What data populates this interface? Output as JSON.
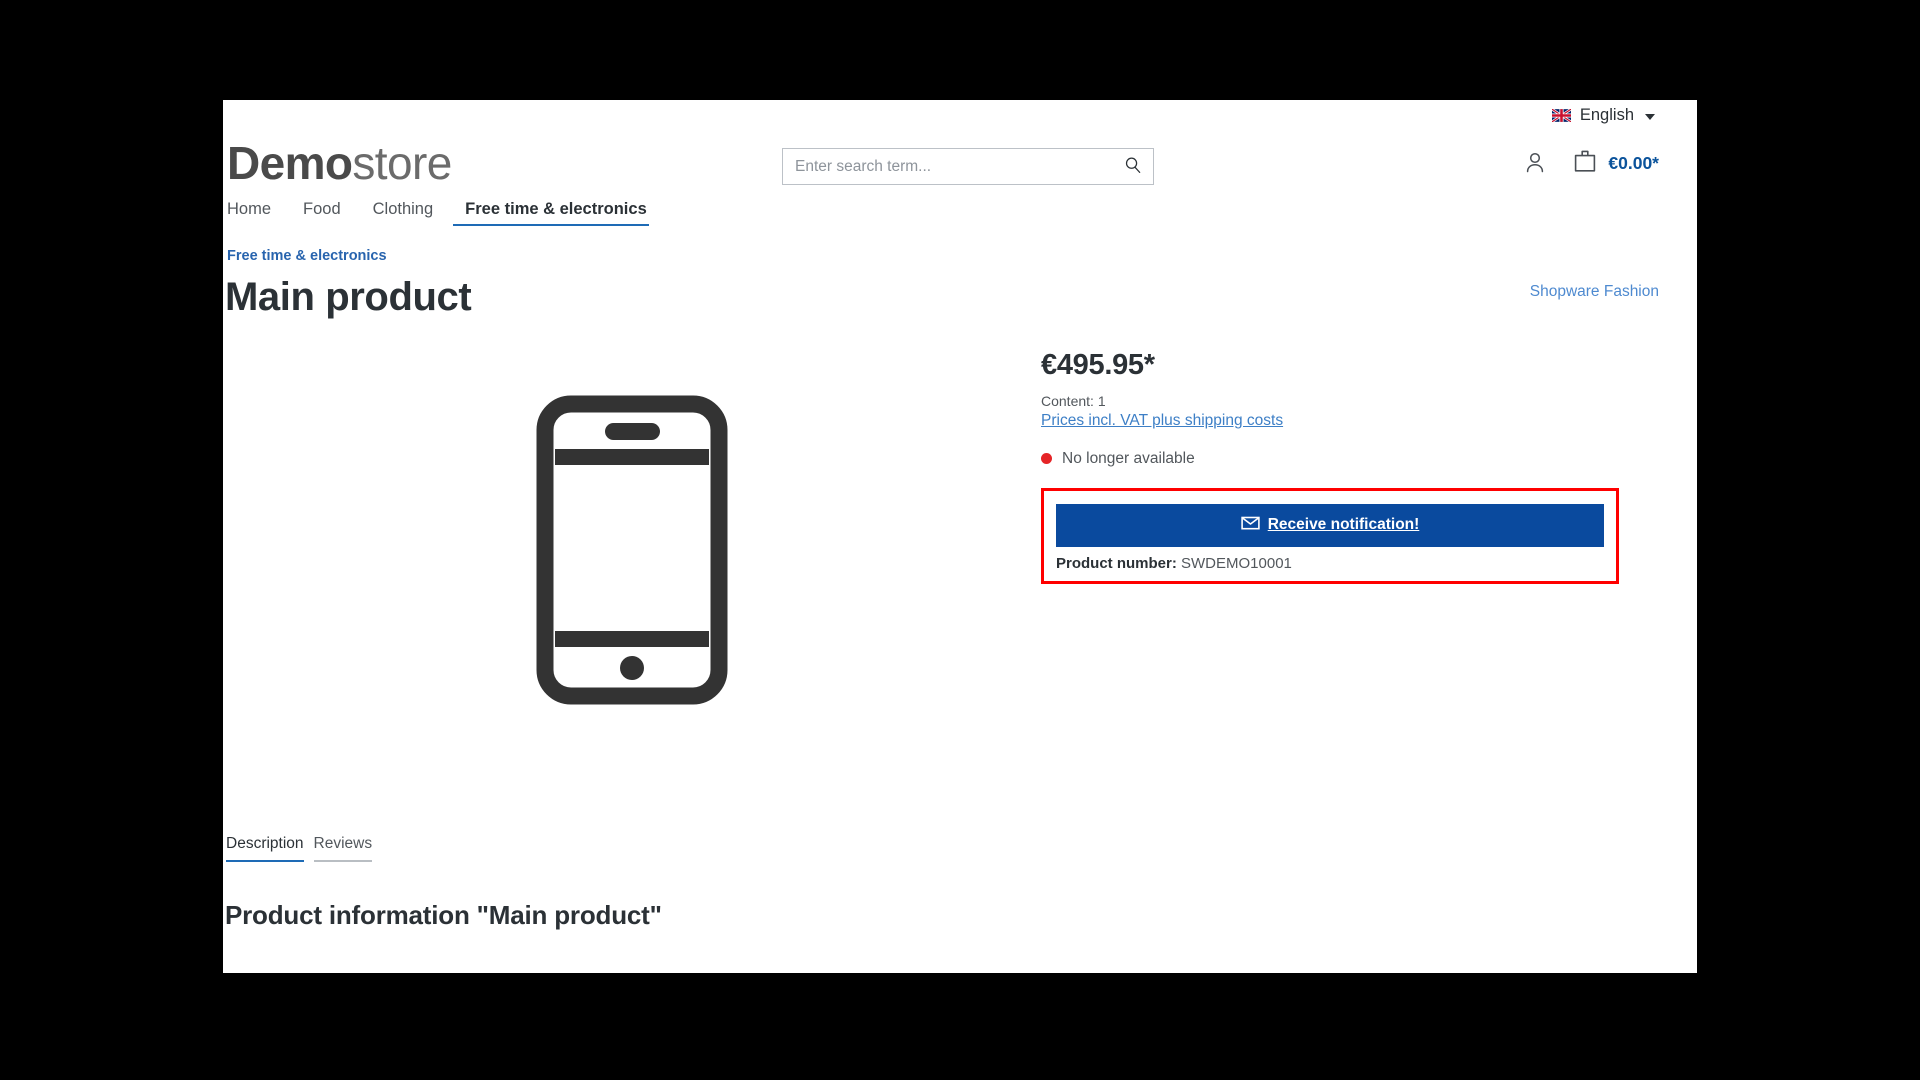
{
  "topbar": {
    "language": {
      "label": "English",
      "flag_icon": "uk-flag-icon",
      "caret_icon": "chevron-down-icon"
    }
  },
  "header": {
    "logo": {
      "bold_part": "Demo",
      "light_part": "store"
    },
    "search": {
      "placeholder": "Enter search term...",
      "value": "",
      "icon": "search-icon"
    },
    "actions": {
      "account_icon": "user-icon",
      "cart_icon": "shopping-bag-icon",
      "cart_amount": "€0.00*"
    }
  },
  "nav": {
    "items": [
      {
        "label": "Home",
        "active": false
      },
      {
        "label": "Food",
        "active": false
      },
      {
        "label": "Clothing",
        "active": false
      },
      {
        "label": "Free time & electronics",
        "active": true
      }
    ]
  },
  "product": {
    "breadcrumb": "Free time & electronics",
    "title": "Main product",
    "manufacturer": "Shopware Fashion",
    "image_icon": "smartphone-icon",
    "price": "€495.95*",
    "content_line": "Content: 1",
    "tax_link": "Prices incl. VAT plus shipping costs",
    "availability": "No longer available",
    "availability_color": "#e52427",
    "notify_button": {
      "label": "Receive notification!",
      "icon": "envelope-icon",
      "color": "#0a4a9e"
    },
    "product_number_label": "Product number:",
    "product_number_value": "SWDEMO10001",
    "highlight_color": "#ff0000"
  },
  "detail_tabs": [
    {
      "label": "Description",
      "active": true
    },
    {
      "label": "Reviews",
      "active": false
    }
  ],
  "description": {
    "heading": "Product information \"Main product\""
  }
}
